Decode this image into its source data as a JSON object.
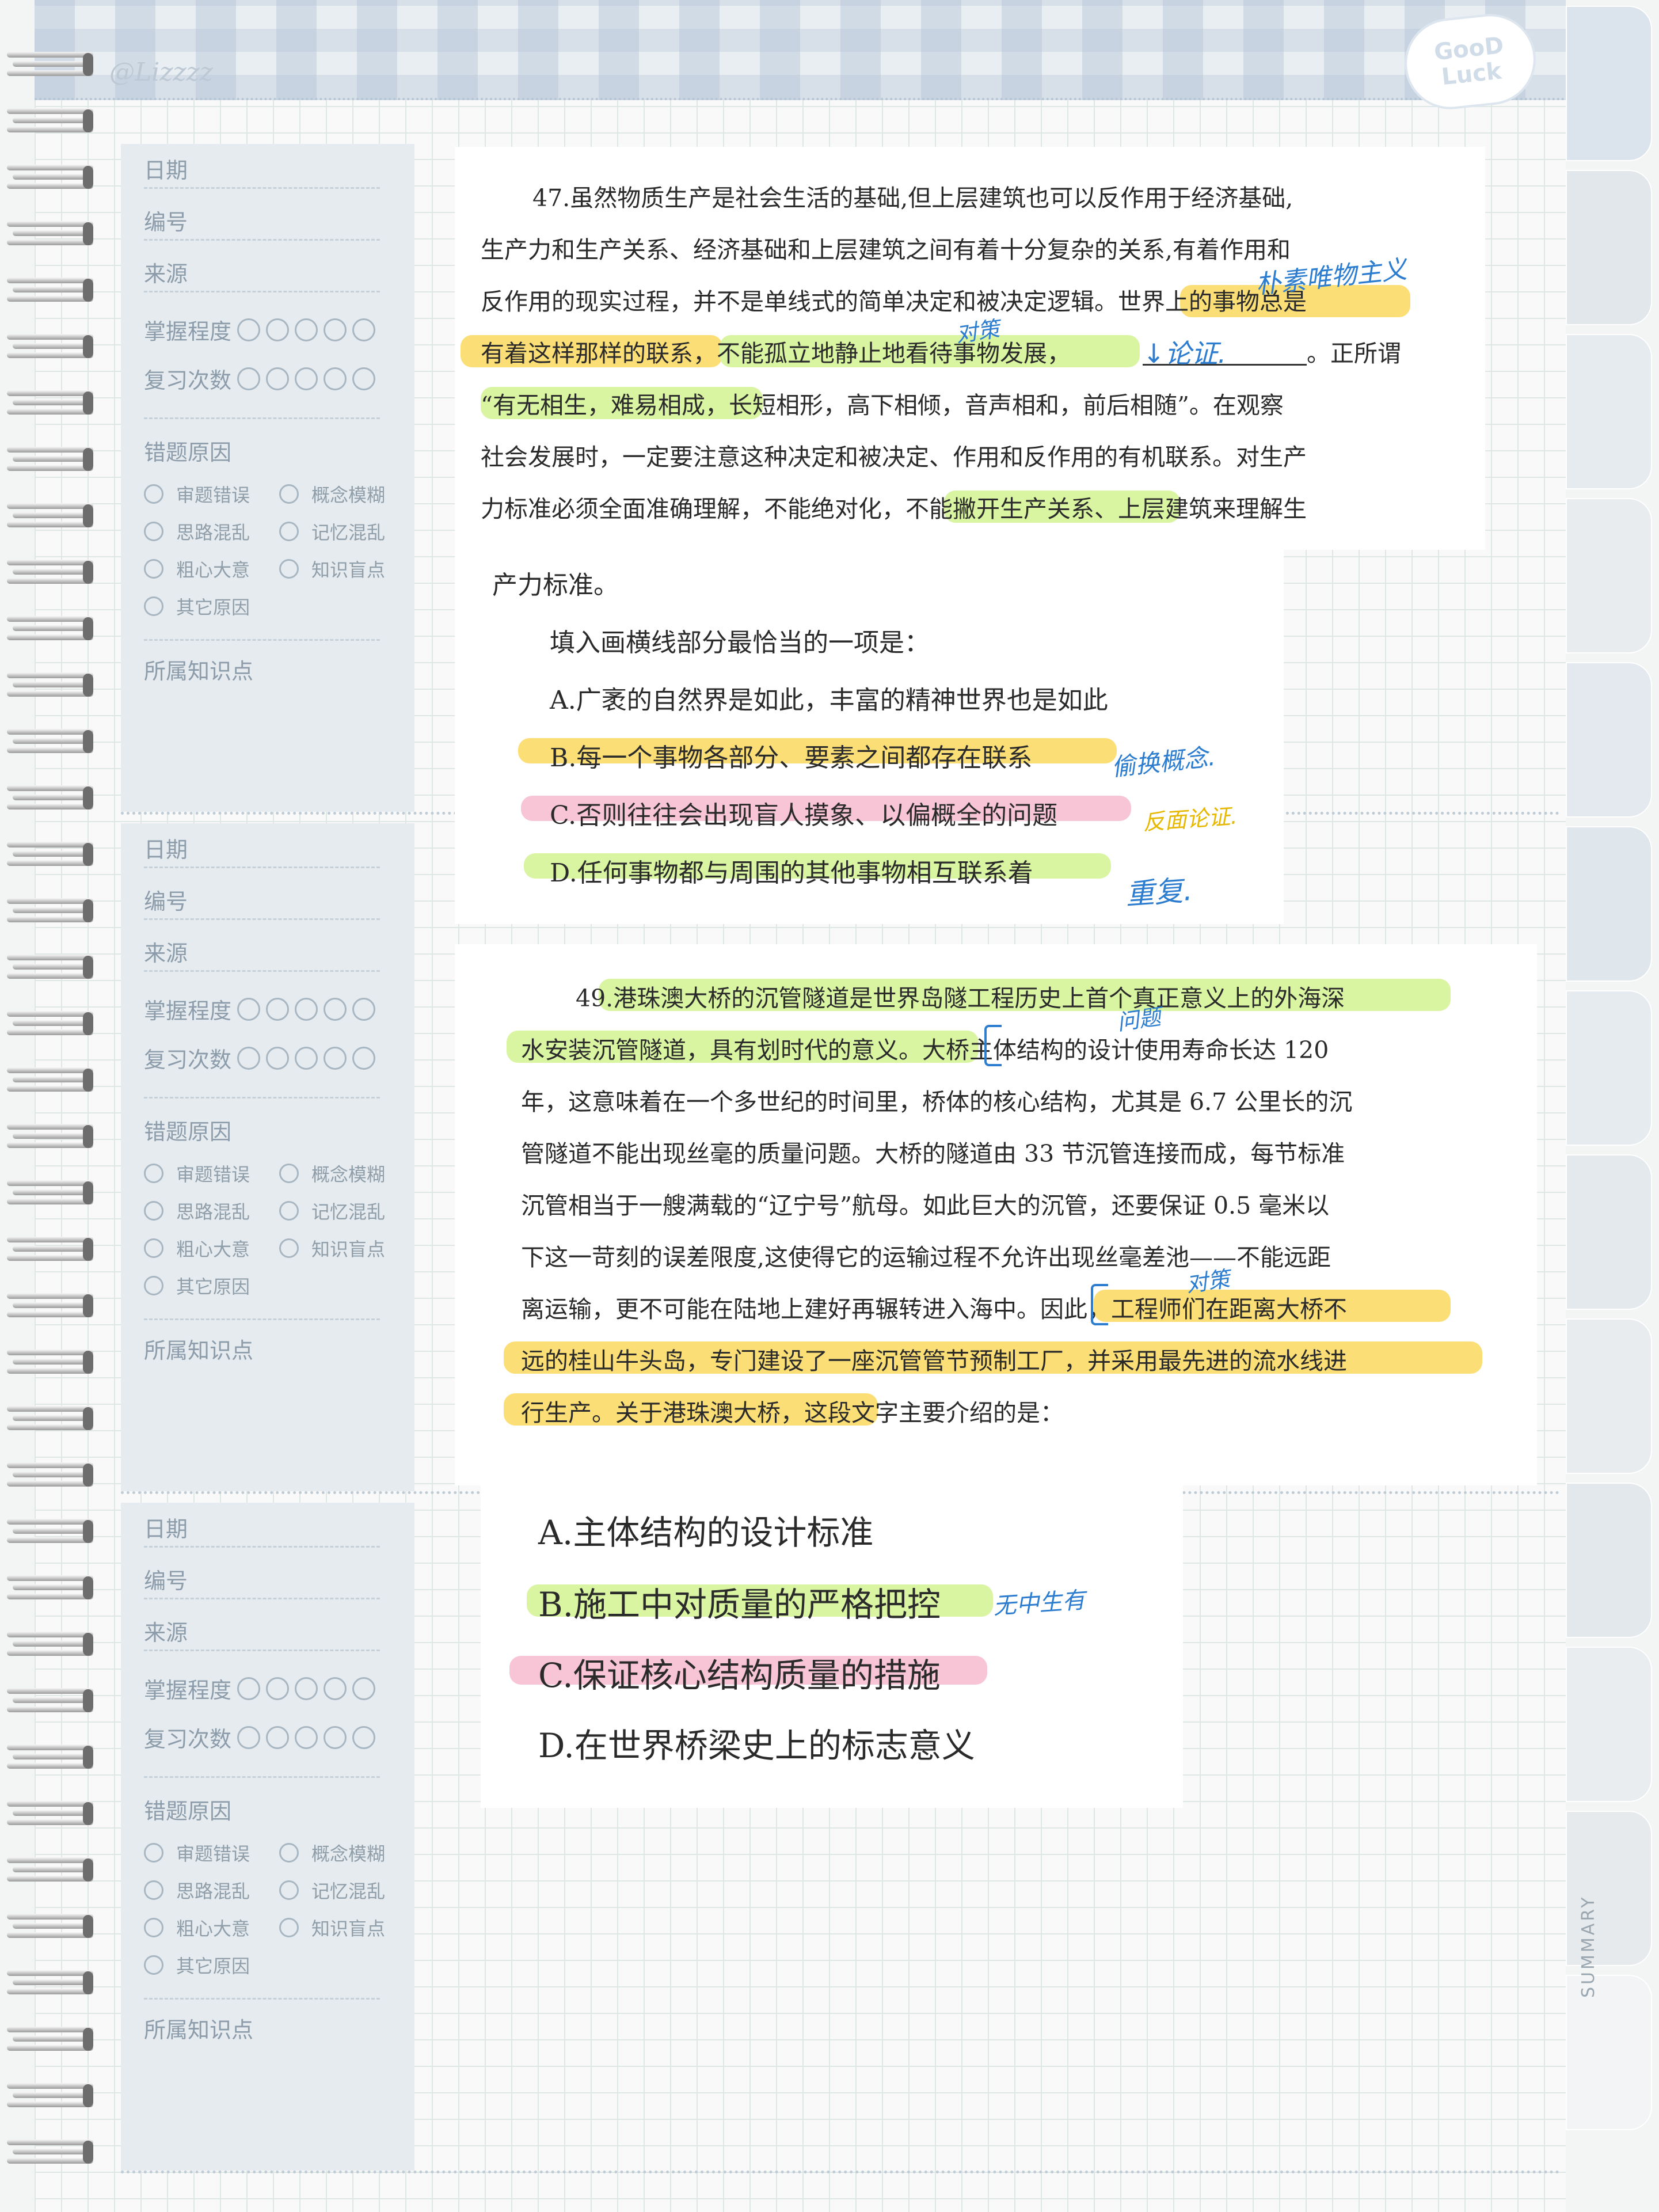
{
  "header": {
    "watermark": "@Lizzzz",
    "sticker_line1": "GooD",
    "sticker_line2": "Luck"
  },
  "sidebar": {
    "date": "日期",
    "number": "编号",
    "source": "来源",
    "mastery": "掌握程度",
    "review": "复习次数",
    "error_reasons_title": "错题原因",
    "reasons": [
      "审题错误",
      "概念模糊",
      "思路混乱",
      "记忆混乱",
      "粗心大意",
      "知识盲点",
      "其它原因"
    ],
    "knowledge": "所属知识点"
  },
  "tabs": {
    "summary": "SUMMARY"
  },
  "q47": {
    "lines": [
      "47.虽然物质生产是社会生活的基础,但上层建筑也可以反作用于经济基础,",
      "生产力和生产关系、经济基础和上层建筑之间有着十分复杂的关系,有着作用和",
      "反作用的现实过程，并不是单线式的简单决定和被决定逻辑。世界上的事物总是",
      "有着这样那样的联系，不能孤立地静止地看待事物发展，",
      "。正所谓",
      "“有无相生，难易相成，长短相形，高下相倾，音声相和，前后相随”。在观察",
      "社会发展时，一定要注意这种决定和被决定、作用和反作用的有机联系。对生产",
      "力标准必须全面准确理解，不能绝对化，不能撇开生产关系、上层建筑来理解生",
      "产力标准。"
    ],
    "prompt": "填入画横线部分最恰当的一项是：",
    "options": [
      "A.广袤的自然界是如此，丰富的精神世界也是如此",
      "B.每一个事物各部分、要素之间都存在联系",
      "C.否则往往会出现盲人摸象、以偏概全的问题",
      "D.任何事物都与周围的其他事物相互联系着"
    ],
    "notes": [
      "朴素唯物主义",
      "对策",
      "↓论证.",
      "偷换概念.",
      "反面论证.",
      "重复."
    ]
  },
  "q49": {
    "lines": [
      "49.港珠澳大桥的沉管隧道是世界岛隧工程历史上首个真正意义上的外海深",
      "水安装沉管隧道，具有划时代的意义。大桥主体结构的设计使用寿命长达 120",
      "年，这意味着在一个多世纪的时间里，桥体的核心结构，尤其是 6.7 公里长的沉",
      "管隧道不能出现丝毫的质量问题。大桥的隧道由 33 节沉管连接而成，每节标准",
      "沉管相当于一艘满载的“辽宁号”航母。如此巨大的沉管，还要保证 0.5 毫米以",
      "下这一苛刻的误差限度,这使得它的运输过程不允许出现丝毫差池——不能远距",
      "离运输，更不可能在陆地上建好再辗转进入海中。因此，工程师们在距离大桥不",
      "远的桂山牛头岛，专门建设了一座沉管管节预制工厂，并采用最先进的流水线进",
      "行生产。关于港珠澳大桥，这段文字主要介绍的是："
    ],
    "options": [
      "A.主体结构的设计标准",
      "B.施工中对质量的严格把控",
      "C.保证核心结构质量的措施",
      "D.在世界桥梁史上的标志意义"
    ],
    "notes": [
      "问题",
      "对策",
      "无中生有"
    ]
  },
  "colors": {
    "highlight_yellow": "#fbdf76",
    "highlight_green": "#d9f5a2",
    "highlight_pink": "#f8c5d6",
    "pen_blue": "#2c7ccf"
  }
}
